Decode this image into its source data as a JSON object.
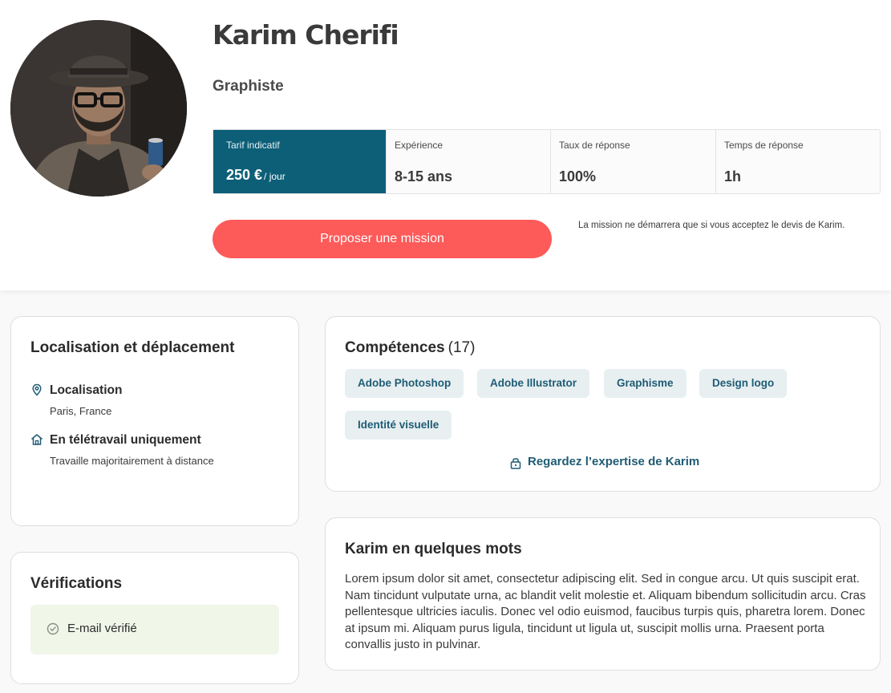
{
  "profile": {
    "name": "Karim Cherifi",
    "role": "Graphiste"
  },
  "stats": [
    {
      "label": "Tarif indicatif",
      "value": "250 €",
      "unit": "/ jour"
    },
    {
      "label": "Expérience",
      "value": "8-15 ans"
    },
    {
      "label": "Taux de réponse",
      "value": "100%"
    },
    {
      "label": "Temps de réponse",
      "value": "1h"
    }
  ],
  "cta": {
    "label": "Proposer une mission",
    "note": "La mission ne démarrera que si vous acceptez le devis de Karim."
  },
  "location": {
    "title": "Localisation et déplacement",
    "items": [
      {
        "icon": "map-pin-icon",
        "heading": "Localisation",
        "sub": "Paris, France"
      },
      {
        "icon": "home-icon",
        "heading": "En télétravail uniquement",
        "sub": "Travaille majoritairement à distance"
      }
    ]
  },
  "verifications": {
    "title": "Vérifications",
    "items": [
      {
        "icon": "check-circle-icon",
        "label": "E-mail vérifié"
      }
    ]
  },
  "skills": {
    "title": "Compétences",
    "count": "17",
    "tags": [
      "Adobe Photoshop",
      "Adobe Illustrator",
      "Graphisme",
      "Design logo",
      "Identité visuelle"
    ],
    "expertise_link": "Regardez l’expertise de Karim"
  },
  "about": {
    "title": "Karim en quelques mots",
    "text": "Lorem ipsum dolor sit amet, consectetur adipiscing elit. Sed in congue arcu. Ut quis suscipit erat. Nam tincidunt vulputate urna, ac blandit velit molestie et. Aliquam bibendum sollicitudin arcu. Cras pellentesque ultricies iaculis. Donec vel odio euismod, faucibus turpis quis, pharetra lorem. Donec at ipsum mi. Aliquam purus ligula, tincidunt ut ligula ut, suscipit mollis urna. Praesent porta convallis justo in pulvinar."
  },
  "colors": {
    "accent": "#0d5f78",
    "cta": "#fd5a5a",
    "tag_bg": "#e7eff1",
    "tag_text": "#1f5c74",
    "verified_bg": "#f0f6e8"
  }
}
